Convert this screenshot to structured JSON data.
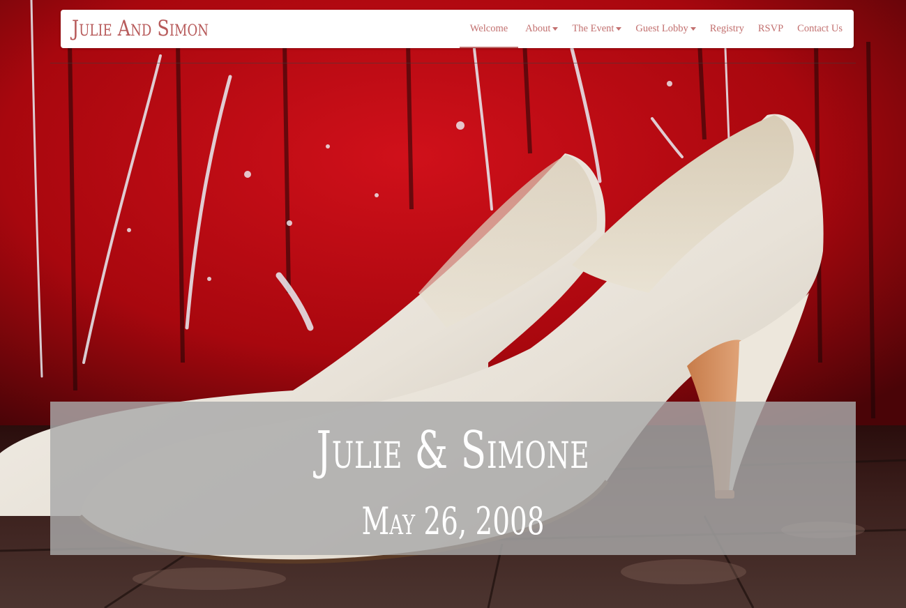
{
  "navbar": {
    "brand": "Julie And Simon",
    "items": [
      {
        "label": "Welcome",
        "active": true,
        "dropdown": false
      },
      {
        "label": "About",
        "active": false,
        "dropdown": true
      },
      {
        "label": "The Event",
        "active": false,
        "dropdown": true
      },
      {
        "label": "Guest Lobby",
        "active": false,
        "dropdown": true
      },
      {
        "label": "Registry",
        "active": false,
        "dropdown": false
      },
      {
        "label": "RSVP",
        "active": false,
        "dropdown": false
      },
      {
        "label": "Contact Us",
        "active": false,
        "dropdown": false
      }
    ],
    "accent_color": "#c2706f"
  },
  "hero": {
    "title": "Julie & Simone",
    "date": "May 26, 2008",
    "background_image": "white-high-heel-shoes-on-red-paint-splattered-wall"
  }
}
